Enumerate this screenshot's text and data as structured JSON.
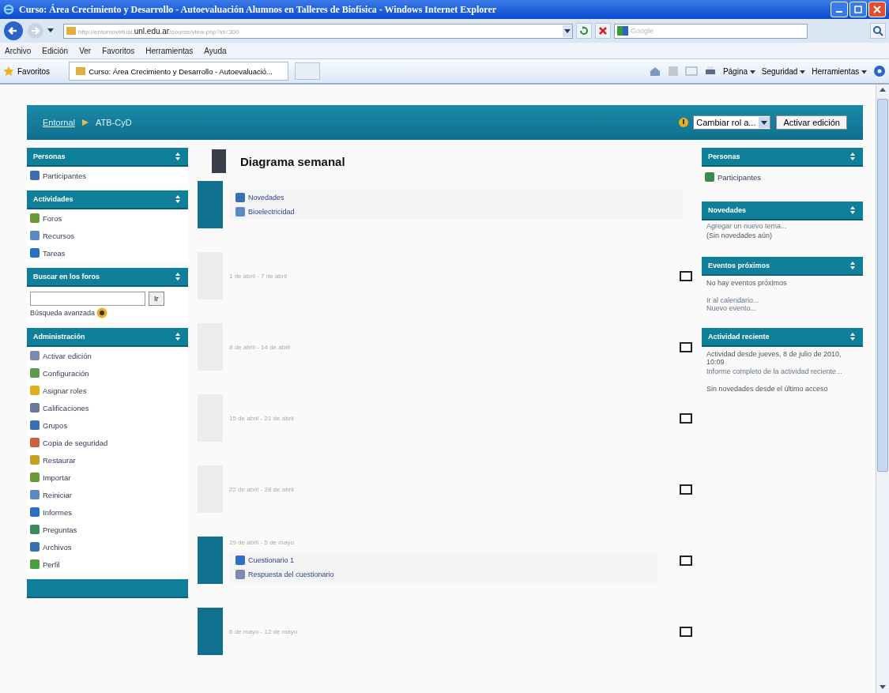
{
  "window": {
    "title": "Curso: Área Crecimiento y Desarrollo - Autoevaluación Alumnos en Talleres de Biofísica - Windows Internet Explorer"
  },
  "address_bar": {
    "prefix": "http://entornovirtual.",
    "domain": "unl.edu.ar",
    "suffix": "/course/view.php?id=300"
  },
  "search": {
    "placeholder": "Google"
  },
  "menu": [
    "Archivo",
    "Edición",
    "Ver",
    "Favoritos",
    "Herramientas",
    "Ayuda"
  ],
  "favorites": "Favoritos",
  "tab": {
    "label": "Curso: Área Crecimiento y Desarrollo - Autoevaluació..."
  },
  "command_bar": [
    "Página",
    "Seguridad",
    "Herramientas"
  ],
  "header": {
    "breadcrumb": [
      "Entornal",
      "ATB-CyD"
    ],
    "role_select": "Cambiar rol a...",
    "edit_button": "Activar edición"
  },
  "left_blocks": [
    {
      "title": "Personas",
      "kind": "list",
      "items": [
        "Participantes"
      ]
    },
    {
      "title": "Actividades",
      "kind": "list",
      "items": [
        "Foros",
        "Recursos",
        "Tareas"
      ]
    },
    {
      "title": "Buscar en los foros",
      "kind": "search",
      "button": "Ir",
      "link": "Búsqueda avanzada"
    },
    {
      "title": "Administración",
      "kind": "list",
      "items": [
        "Activar edición",
        "Configuración",
        "Asignar roles",
        "Calificaciones",
        "Grupos",
        "Copia de seguridad",
        "Restaurar",
        "Importar",
        "Reiniciar",
        "Informes",
        "Preguntas",
        "Archivos",
        "Perfil"
      ]
    },
    {
      "kind": "empty"
    }
  ],
  "course": {
    "heading": "Diagrama semanal",
    "sections": [
      {
        "kind": "active",
        "items": [
          "Novedades",
          "Bioelectricidad"
        ]
      },
      {
        "kind": "empty",
        "date": "1 de abril - 7 de abril"
      },
      {
        "kind": "empty",
        "date": "8 de abril - 14 de abril"
      },
      {
        "kind": "empty",
        "date": "15 de abril - 21 de abril"
      },
      {
        "kind": "empty",
        "date": "22 de abril - 28 de abril"
      },
      {
        "kind": "active",
        "date": "29 de abril - 5 de mayo",
        "items": [
          "Cuestionario 1",
          "Respuesta del cuestionario"
        ]
      },
      {
        "kind": "active",
        "date": "6 de mayo - 12 de mayo"
      }
    ]
  },
  "right_blocks": [
    {
      "title": "Personas",
      "items": [
        {
          "kind": "icon-link",
          "text": "Participantes"
        }
      ]
    },
    {
      "title": "Novedades",
      "items": [
        {
          "kind": "link",
          "text": "Agregar un nuevo tema..."
        },
        {
          "kind": "text",
          "text": "(Sin novedades aún)"
        }
      ]
    },
    {
      "title": "Eventos próximos",
      "items": [
        {
          "kind": "text",
          "text": "No hay eventos próximos"
        },
        {
          "kind": "gap"
        },
        {
          "kind": "link",
          "text": "Ir al calendario..."
        },
        {
          "kind": "link",
          "text": "Nuevo evento..."
        }
      ]
    },
    {
      "title": "Actividad reciente",
      "items": [
        {
          "kind": "text",
          "text": "Actividad desde jueves, 8 de julio de 2010, 10:09"
        },
        {
          "kind": "link",
          "text": "Informe completo de la actividad reciente..."
        },
        {
          "kind": "gap"
        },
        {
          "kind": "text",
          "text": "Sin novedades desde el último acceso"
        }
      ]
    }
  ]
}
